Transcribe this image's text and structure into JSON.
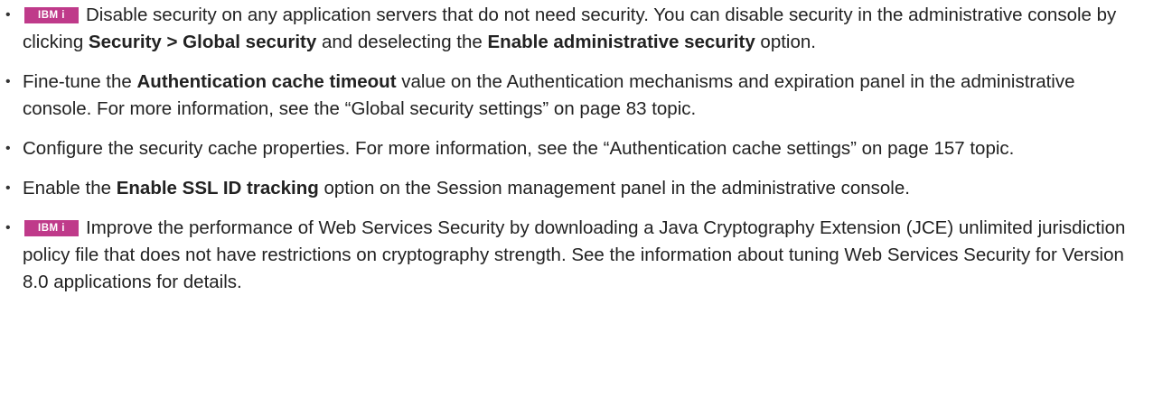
{
  "colors": {
    "badge_background": "#bf3a8a",
    "text": "#222222"
  },
  "badge": {
    "label": "IBM i"
  },
  "items": [
    {
      "segments": [
        {
          "text": "Disable security on any application servers that do not need security. You can disable security in the administrative console by clicking ",
          "bold": false
        },
        {
          "text": "Security > Global security",
          "bold": true
        },
        {
          "text": " and deselecting the ",
          "bold": false
        },
        {
          "text": "Enable administrative security",
          "bold": true
        },
        {
          "text": " option.",
          "bold": false
        }
      ]
    },
    {
      "segments": [
        {
          "text": "Fine-tune the ",
          "bold": false
        },
        {
          "text": "Authentication cache timeout",
          "bold": true
        },
        {
          "text": " value on the Authentication mechanisms and expiration panel in the administrative console. For more information, see the “Global security settings” on page 83 topic.",
          "bold": false
        }
      ]
    },
    {
      "segments": [
        {
          "text": "Configure the security cache properties. For more information, see the “Authentication cache settings” on page 157 topic.",
          "bold": false
        }
      ]
    },
    {
      "segments": [
        {
          "text": "Enable the ",
          "bold": false
        },
        {
          "text": "Enable SSL ID tracking",
          "bold": true
        },
        {
          "text": " option on the Session management panel in the administrative console.",
          "bold": false
        }
      ]
    },
    {
      "segments": [
        {
          "text": "Improve the performance of Web Services Security by downloading a Java Cryptography Extension (JCE) unlimited jurisdiction policy file that does not have restrictions on cryptography strength. See the information about tuning Web Services Security for Version 8.0 applications for details.",
          "bold": false
        }
      ]
    }
  ]
}
